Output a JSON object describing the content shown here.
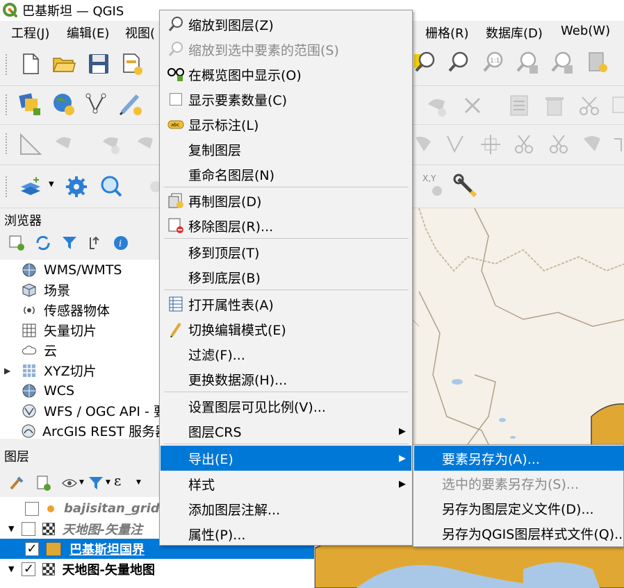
{
  "window": {
    "title": "巴基斯坦 — QGIS"
  },
  "menubar": [
    {
      "label": "工程(J)"
    },
    {
      "label": "编辑(E)"
    },
    {
      "label": "视图("
    },
    {
      "label": "栅格(R)"
    },
    {
      "label": "数据库(D)"
    },
    {
      "label": "Web(W)"
    }
  ],
  "toolbars": {
    "row1": [
      "new-project-icon",
      "open-folder-icon",
      "save-icon",
      "save-as-icon",
      "zoom-to-layer-icon",
      "zoom-selection-icon",
      "zoom-native-icon",
      "zoom-last-icon",
      "zoom-next-icon",
      "new-bookmark-icon"
    ],
    "row2": [
      "data-source-manager-icon",
      "new-layer-icon",
      "digitize-icon",
      "pencil-icon",
      "vertex-tool-icon",
      "delete-icon",
      "cut-icon",
      "copy-icon"
    ],
    "row3": [
      "measure-icon",
      "move-feature-icon",
      "rotate-icon",
      "reshape-icon",
      "snapping-icon",
      "split-icon",
      "merge-icon",
      "delete-part-icon"
    ],
    "row4": [
      "add-layer-icon",
      "settings-gear-icon",
      "identify-icon",
      "xy-coordinate-icon",
      "wrench-icon"
    ],
    "coord_label": "X,Y"
  },
  "browser": {
    "title": "浏览器",
    "items": [
      {
        "label": "WMS/WMTS",
        "icon": "globe-icon",
        "expandable": false
      },
      {
        "label": "场景",
        "icon": "cube-icon",
        "expandable": false
      },
      {
        "label": "传感器物体",
        "icon": "sensor-icon",
        "expandable": false
      },
      {
        "label": "矢量切片",
        "icon": "grid-icon",
        "expandable": false
      },
      {
        "label": "云",
        "icon": "cloud-icon",
        "expandable": false
      },
      {
        "label": "XYZ切片",
        "icon": "tile-grid-icon",
        "expandable": true
      },
      {
        "label": "WCS",
        "icon": "globe-icon",
        "expandable": false
      },
      {
        "label": "WFS / OGC API - 要",
        "icon": "wfs-icon",
        "expandable": false
      },
      {
        "label": "ArcGIS REST 服务器",
        "icon": "arcgis-icon",
        "expandable": false
      }
    ]
  },
  "layers_panel": {
    "title": "图层",
    "layers": [
      {
        "label": "bajisitan_grid",
        "checked": false,
        "style": "italic-bold-gray",
        "symbol_color": "#f0a030",
        "symbol": "dot"
      },
      {
        "label": "天地图-矢量注",
        "checked": false,
        "style": "italic-bold-gray",
        "symbol": "raster",
        "expanded": true
      },
      {
        "label": "巴基斯坦国界",
        "checked": true,
        "style": "selected",
        "symbol_color": "#e0a832",
        "symbol": "fill"
      },
      {
        "label": "天地图-矢量地图",
        "checked": true,
        "style": "bold",
        "symbol": "raster",
        "expanded": true
      }
    ]
  },
  "context_menu": {
    "items": [
      {
        "label": "缩放到图层(Z)",
        "icon": "zoom-to-layer-icon",
        "disabled": false,
        "submenu": false
      },
      {
        "label": "缩放到选中要素的范围(S)",
        "icon": "zoom-selection-icon",
        "disabled": true,
        "submenu": false
      },
      {
        "label": "在概览图中显示(O)",
        "icon": "overview-glasses-icon",
        "disabled": false,
        "submenu": false
      },
      {
        "label": "显示要素数量(C)",
        "icon": "checkbox-icon",
        "disabled": false,
        "submenu": false
      },
      {
        "label": "显示标注(L)",
        "icon": "label-abc-icon",
        "disabled": false,
        "submenu": false
      },
      {
        "label": "复制图层",
        "icon": "",
        "disabled": false,
        "submenu": false
      },
      {
        "label": "重命名图层(N)",
        "icon": "",
        "disabled": false,
        "submenu": false
      },
      {
        "label": "再制图层(D)",
        "icon": "duplicate-layer-icon",
        "disabled": false,
        "submenu": false
      },
      {
        "label": "移除图层(R)...",
        "icon": "remove-layer-icon",
        "disabled": false,
        "submenu": false
      },
      {
        "label": "移到顶层(T)",
        "icon": "",
        "disabled": false,
        "submenu": false
      },
      {
        "label": "移到底层(B)",
        "icon": "",
        "disabled": false,
        "submenu": false
      },
      {
        "label": "打开属性表(A)",
        "icon": "attribute-table-icon",
        "disabled": false,
        "submenu": false
      },
      {
        "label": "切换编辑模式(E)",
        "icon": "pencil-edit-icon",
        "disabled": false,
        "submenu": false
      },
      {
        "label": "过滤(F)...",
        "icon": "",
        "disabled": false,
        "submenu": false
      },
      {
        "label": "更换数据源(H)...",
        "icon": "",
        "disabled": false,
        "submenu": false
      },
      {
        "label": "设置图层可见比例(V)...",
        "icon": "",
        "disabled": false,
        "submenu": false
      },
      {
        "label": "图层CRS",
        "icon": "",
        "disabled": false,
        "submenu": true
      },
      {
        "label": "导出(E)",
        "icon": "",
        "disabled": false,
        "submenu": true,
        "active": true
      },
      {
        "label": "样式",
        "icon": "",
        "disabled": false,
        "submenu": true
      },
      {
        "label": "添加图层注解...",
        "icon": "",
        "disabled": false,
        "submenu": false
      },
      {
        "label": "属性(P)...",
        "icon": "",
        "disabled": false,
        "submenu": false
      }
    ]
  },
  "export_submenu": {
    "items": [
      {
        "label": "要素另存为(A)...",
        "active": true,
        "disabled": false
      },
      {
        "label": "选中的要素另存为(S)...",
        "active": false,
        "disabled": true
      },
      {
        "label": "另存为图层定义文件(D)...",
        "active": false,
        "disabled": false
      },
      {
        "label": "另存为QGIS图层样式文件(Q)...",
        "active": false,
        "disabled": false
      }
    ]
  },
  "colors": {
    "selection": "#0078d7",
    "pakistan_fill": "#e0a832",
    "map_background": "#f5f1e8",
    "water": "#a9c8e8"
  }
}
